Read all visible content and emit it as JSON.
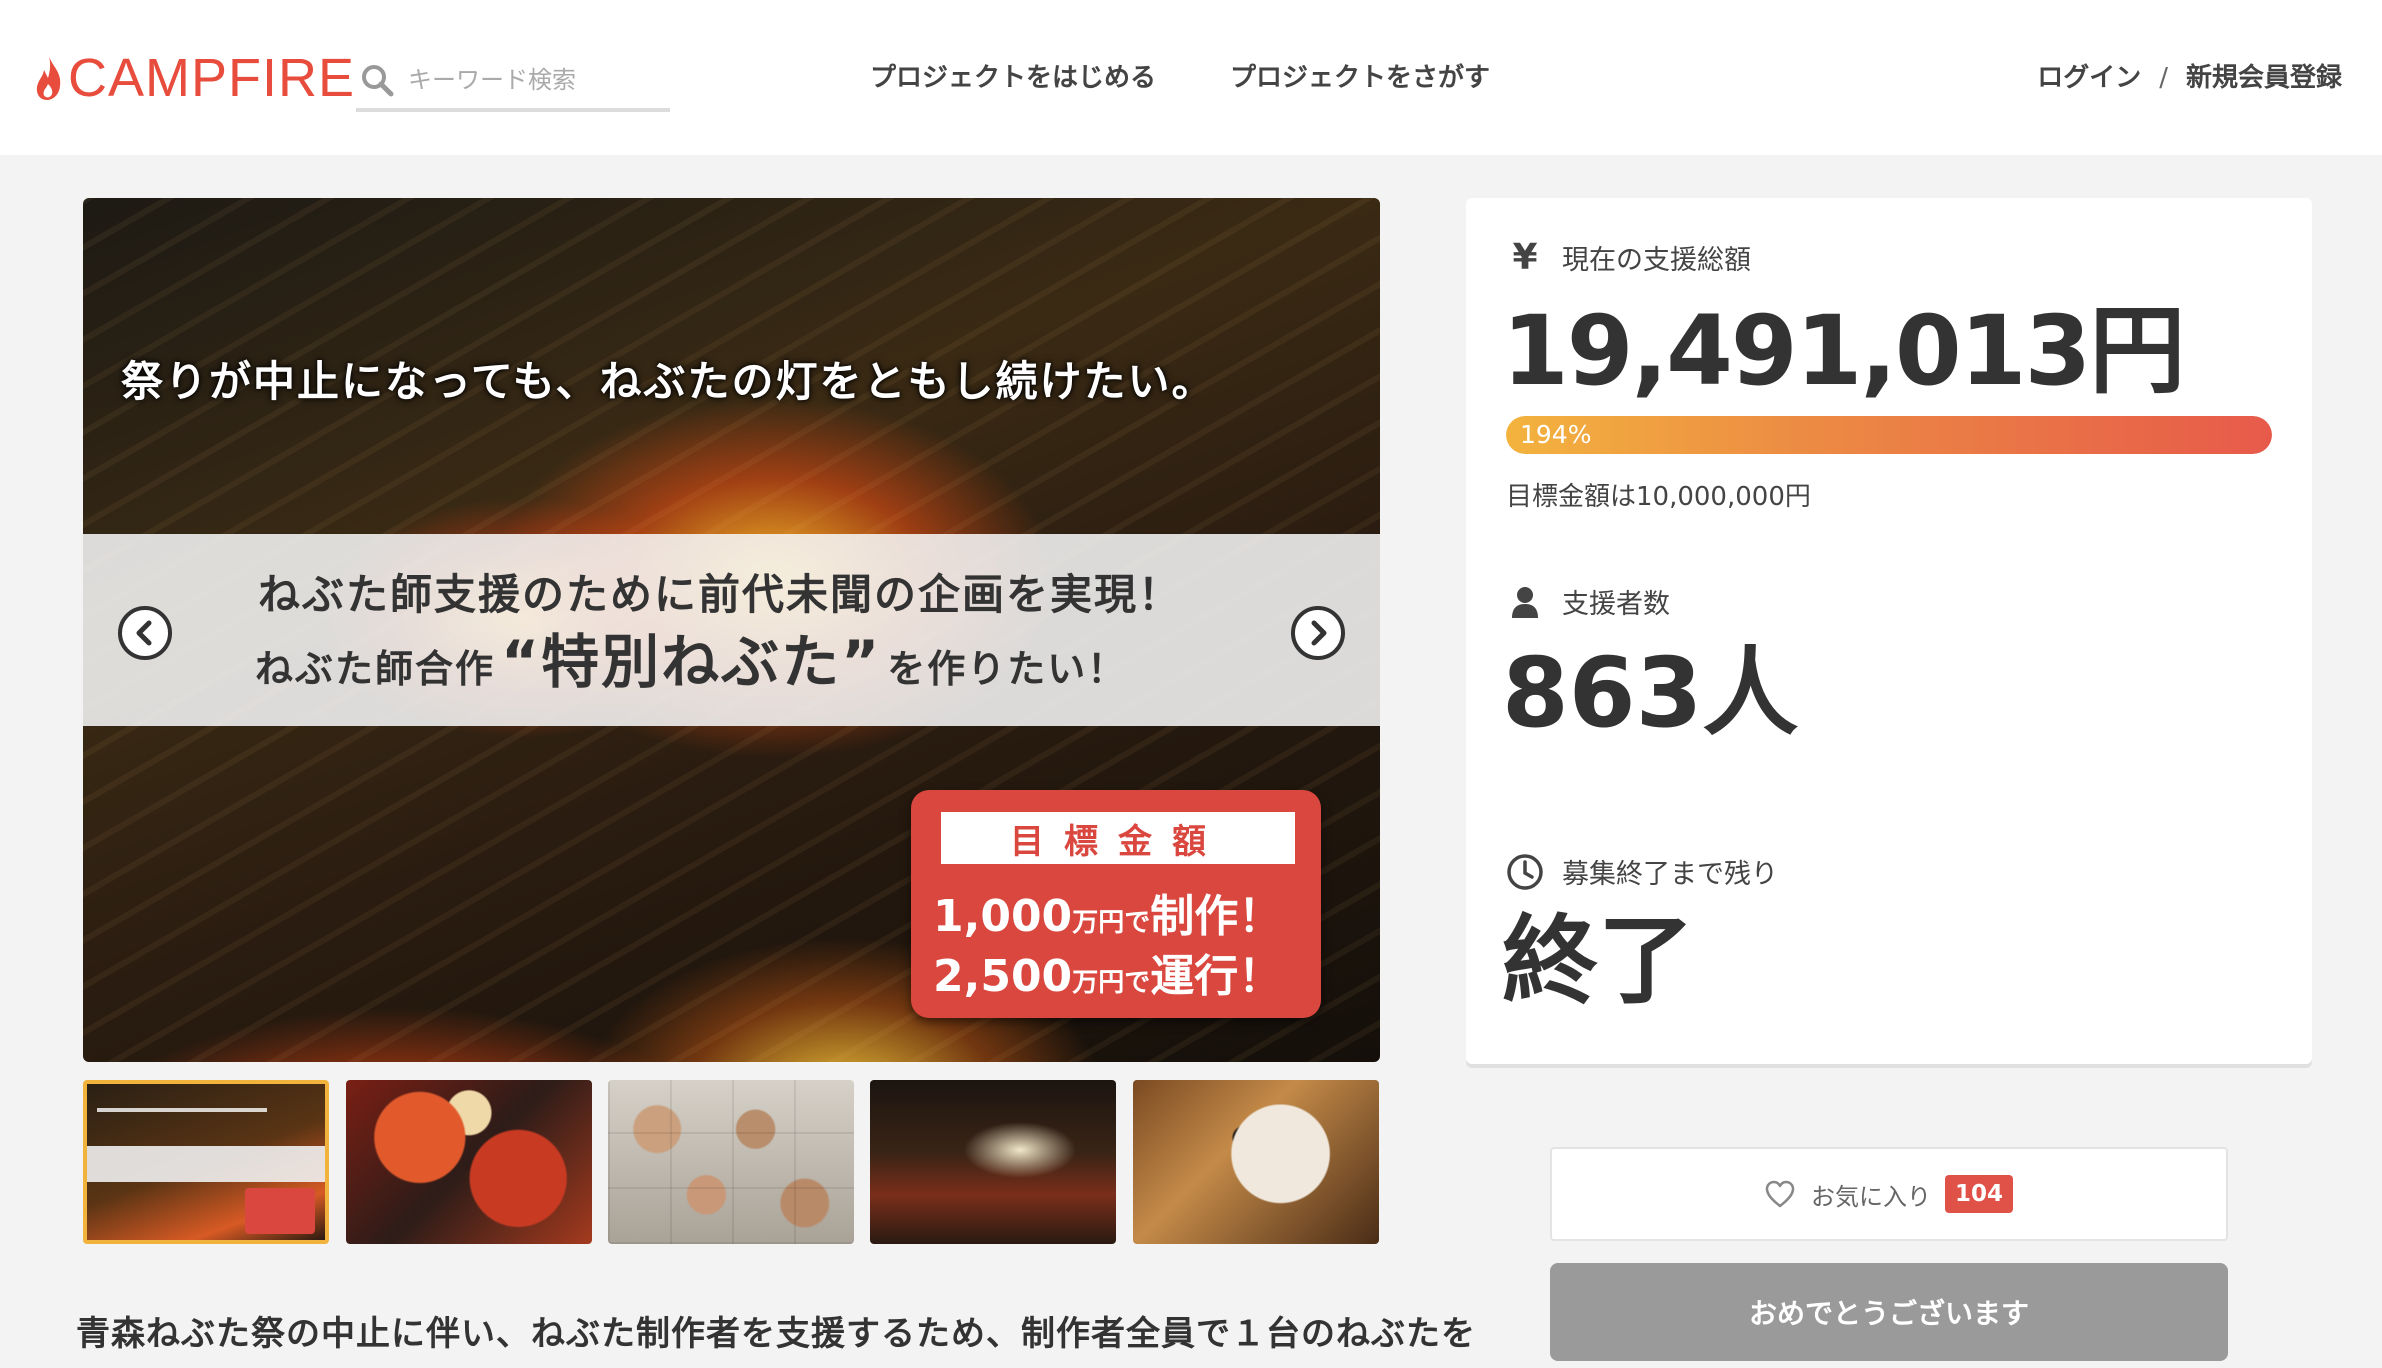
{
  "header": {
    "logo_text": "CAMPFIRE",
    "search_placeholder": "キーワード検索",
    "nav_start": "プロジェクトをはじめる",
    "nav_find": "プロジェクトをさがす",
    "login": "ログイン",
    "separator": "/",
    "register": "新規会員登録"
  },
  "hero": {
    "top_text": "祭りが中止になっても、ねぶたの灯をともし続けたい。",
    "band_line1": "ねぶた師支援のために前代未聞の企画を実現！",
    "band_line2_pre": "ねぶた師合作",
    "band_line2_big": "“特別ねぶた”",
    "band_line2_post": "を作りたい！",
    "goal_title": "目標金額",
    "goal_line1_num": "1,000",
    "goal_line1_unit": "万円で",
    "goal_line1_action": "制作！",
    "goal_line2_num": "2,500",
    "goal_line2_unit": "万円で",
    "goal_line2_action": "運行！"
  },
  "thumbnails": [
    {
      "label": "thumbnail-1",
      "active": true
    },
    {
      "label": "thumbnail-2",
      "active": false
    },
    {
      "label": "thumbnail-3",
      "active": false
    },
    {
      "label": "thumbnail-4",
      "active": false
    },
    {
      "label": "thumbnail-5",
      "active": false
    }
  ],
  "description": "青森ねぶた祭の中止に伴い、ねぶた制作者を支援するため、制作者全員で１台のねぶたを",
  "stats": {
    "currency_symbol": "¥",
    "amount_label": "現在の支援総額",
    "amount": "19,491,013円",
    "progress_percent": 194,
    "progress_text": "194%",
    "goal_text": "目標金額は10,000,000円",
    "backers_label": "支援者数",
    "backers": "863人",
    "remaining_label": "募集終了まで残り",
    "remaining": "終了"
  },
  "actions": {
    "favorite_label": "お気に入り",
    "favorite_count": "104",
    "done_label": "おめでとうございます"
  },
  "colors": {
    "brand": "#e74c3c",
    "progress_start": "#f3b33e",
    "progress_end": "#e75a4a",
    "badge": "#e05248",
    "done_button": "#9a9a9a"
  }
}
